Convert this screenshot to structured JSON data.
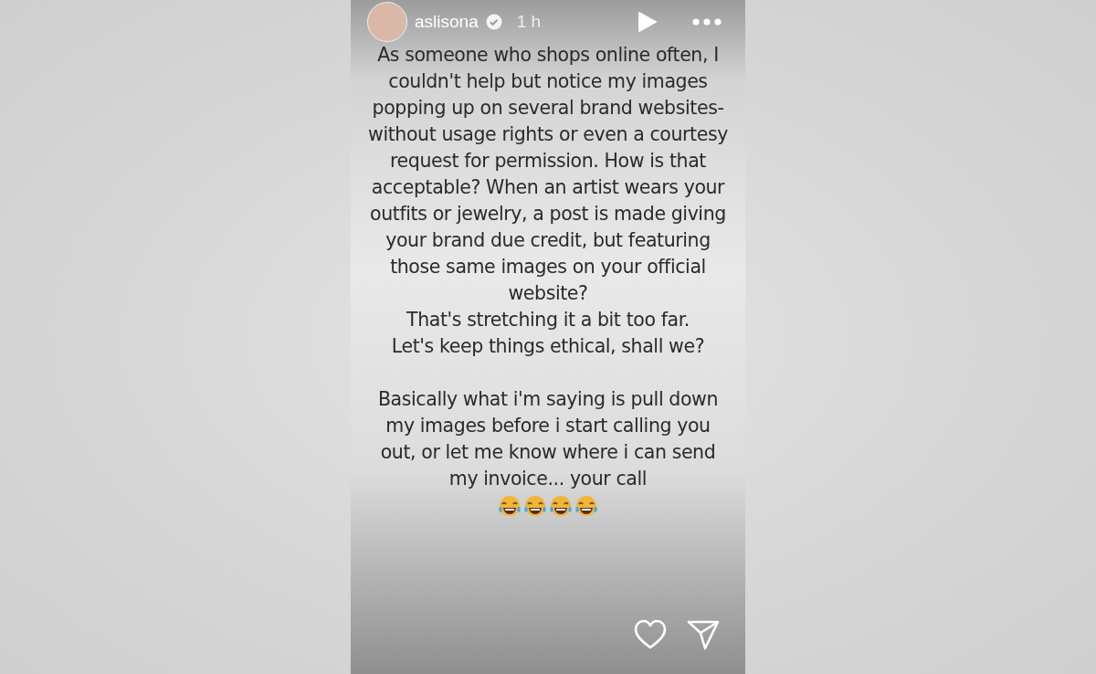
{
  "story": {
    "username": "aslisona",
    "verified": true,
    "time": "1 h",
    "paragraphs": [
      "As someone who shops online often, I couldn't help but notice my images popping up on several brand websites-without usage rights or even a courtesy request for permission. How is that acceptable? When an artist wears your outfits or jewelry, a post is made giving your brand due credit, but featuring those same images on your official website?",
      "That's stretching it a bit too far.",
      "Let's keep things ethical, shall we?",
      "Basically what i'm saying is pull down my images before i start calling you out, or let me know where i can send my invoice... your call"
    ],
    "emojis": [
      {
        "kind": "laughing"
      },
      {
        "kind": "laughing"
      },
      {
        "kind": "laughing"
      },
      {
        "kind": "laughing"
      }
    ]
  }
}
